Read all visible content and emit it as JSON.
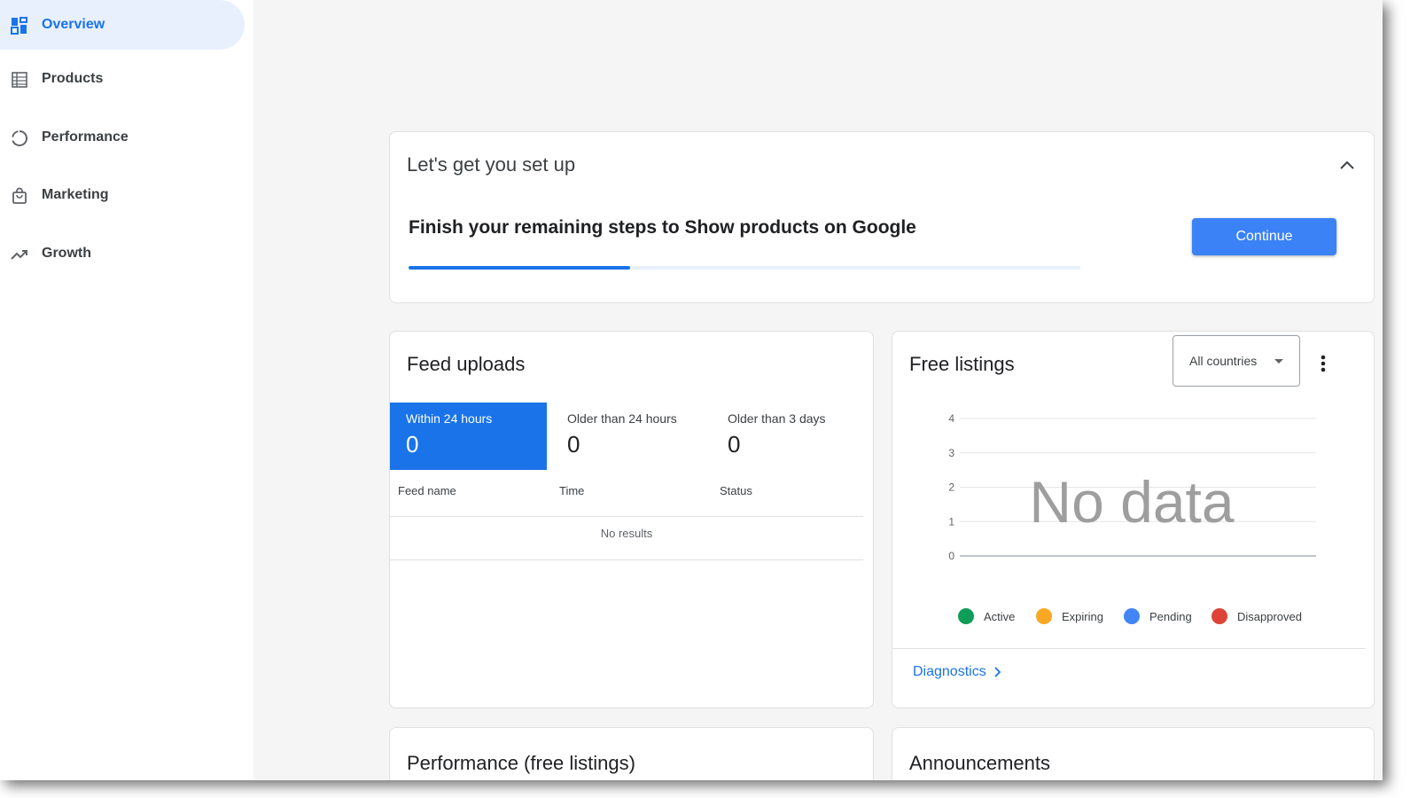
{
  "sidebar": {
    "items": [
      {
        "label": "Overview",
        "icon": "dashboard-icon",
        "active": true
      },
      {
        "label": "Products",
        "icon": "list-icon"
      },
      {
        "label": "Performance",
        "icon": "circle-progress-icon"
      },
      {
        "label": "Marketing",
        "icon": "shopping-bag-icon"
      },
      {
        "label": "Growth",
        "icon": "trending-up-icon"
      }
    ]
  },
  "setup": {
    "title": "Let's get you set up",
    "message": "Finish your remaining steps to Show products on Google",
    "progress_fraction": 0.33,
    "continue_label": "Continue"
  },
  "feed": {
    "title": "Feed uploads",
    "tabs": [
      {
        "label": "Within 24 hours",
        "count": "0",
        "active": true
      },
      {
        "label": "Older than 24 hours",
        "count": "0"
      },
      {
        "label": "Older than 3 days",
        "count": "0"
      }
    ],
    "columns": [
      "Feed name",
      "Time",
      "Status"
    ],
    "empty_text": "No results"
  },
  "listings": {
    "title": "Free listings",
    "country_select": "All countries",
    "no_data": "No data",
    "diagnostics_label": "Diagnostics",
    "legend": [
      {
        "label": "Active",
        "color": "#0f9d58"
      },
      {
        "label": "Expiring",
        "color": "#f9a825"
      },
      {
        "label": "Pending",
        "color": "#4285f4"
      },
      {
        "label": "Disapproved",
        "color": "#db4437"
      }
    ]
  },
  "chart_data": {
    "type": "line",
    "title": "",
    "xlabel": "",
    "ylabel": "",
    "y_ticks": [
      "4",
      "3",
      "2",
      "1",
      "0"
    ],
    "ylim": [
      0,
      4
    ],
    "grid": true,
    "series": []
  },
  "bottom_cards": {
    "performance_title": "Performance (free listings)",
    "announcements_title": "Announcements"
  },
  "colors": {
    "accent": "#1a73e8",
    "button": "#3b82f6",
    "active_nav_bg": "#e8f0fe"
  }
}
